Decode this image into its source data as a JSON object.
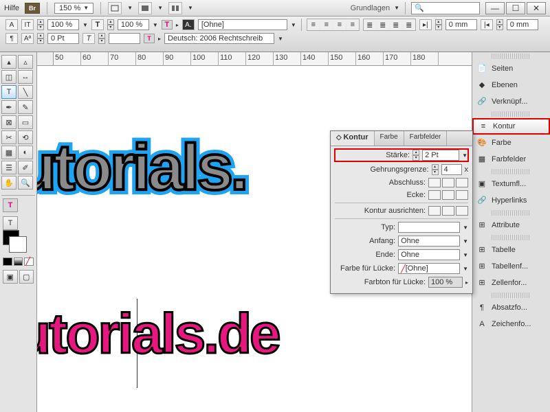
{
  "topbar": {
    "help": "Hilfe",
    "br": "Br",
    "zoom": "150 %",
    "workspace": "Grundlagen"
  },
  "ctrlbar": {
    "size1": "100 %",
    "size2": "100 %",
    "charstyle": "[Ohne]",
    "kern": "0 Pt",
    "lang": "Deutsch: 2006 Rechtschreib",
    "inset1": "0 mm",
    "inset2": "0 mm"
  },
  "ruler": [
    "50",
    "60",
    "70",
    "80",
    "90",
    "100",
    "110",
    "120",
    "130",
    "140",
    "150",
    "160",
    "170",
    "180"
  ],
  "canvas": {
    "text_top": "utorials.",
    "text_bottom": "utorials.de"
  },
  "kontur_panel": {
    "tab1": "Kontur",
    "tab2": "Farbe",
    "tab3": "Farbfelder",
    "staerke_label": "Stärke:",
    "staerke_val": "2 Pt",
    "gehrung_label": "Gehrungsgrenze:",
    "gehrung_val": "4",
    "gehrung_suffix": "x",
    "abschluss_label": "Abschluss:",
    "ecke_label": "Ecke:",
    "ausrichten_label": "Kontur ausrichten:",
    "typ_label": "Typ:",
    "anfang_label": "Anfang:",
    "anfang_val": "Ohne",
    "ende_label": "Ende:",
    "ende_val": "Ohne",
    "farbe_luecke_label": "Farbe für Lücke:",
    "farbe_luecke_val": "[Ohne]",
    "farbton_label": "Farbton für Lücke:",
    "farbton_val": "100 %"
  },
  "right_panels": {
    "items": [
      {
        "label": "Seiten"
      },
      {
        "label": "Ebenen"
      },
      {
        "label": "Verknüpf..."
      },
      {
        "label": "Kontur",
        "sel": true
      },
      {
        "label": "Farbe"
      },
      {
        "label": "Farbfelder"
      },
      {
        "label": "Textumfl..."
      },
      {
        "label": "Hyperlinks"
      },
      {
        "label": "Attribute"
      },
      {
        "label": "Tabelle"
      },
      {
        "label": "Tabellenf..."
      },
      {
        "label": "Zellenfor..."
      },
      {
        "label": "Absatzfo..."
      },
      {
        "label": "Zeichenfo..."
      }
    ]
  }
}
